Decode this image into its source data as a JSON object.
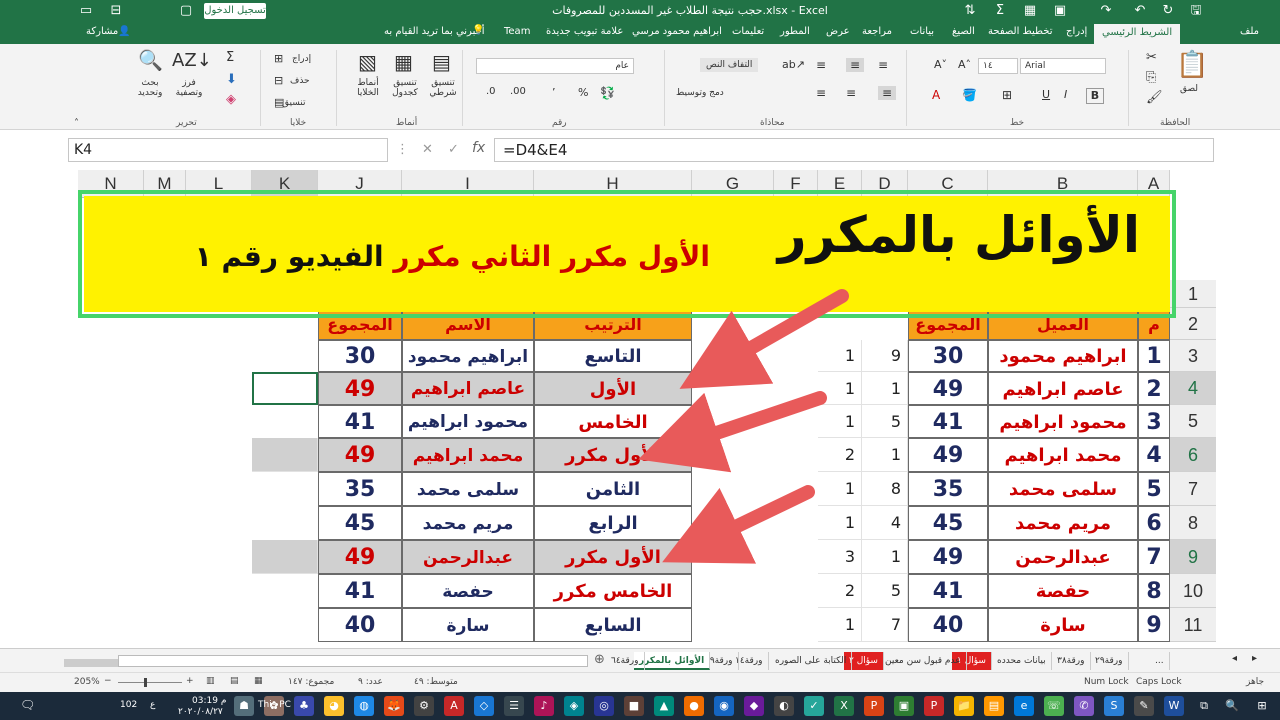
{
  "titlebar": {
    "title": "حجب نتيجة الطلاب غير المسددين للمصروفات.xlsx - Excel",
    "signin": "تسجيل الدخول"
  },
  "tabs": [
    "ملف",
    "الشريط الرئيسي",
    "إدراج",
    "تخطيط الصفحة",
    "الصيغ",
    "بيانات",
    "مراجعة",
    "عرض",
    "المطور",
    "تعليمات",
    "ابراهيم محمود مرسي",
    "علامة تبويب جديدة",
    "Team",
    "أخبرني بما تريد القيام به",
    "مشاركة"
  ],
  "ribbon": {
    "clipboard": "الحافظة",
    "font": "خط",
    "alignment": "محاذاة",
    "number": "رقم",
    "styles": "أنماط",
    "cells": "خلايا",
    "editing": "تحرير",
    "font_name": "Arial",
    "font_size": "١٤",
    "number_format": "عام",
    "paste": "لصق",
    "wrap": "التفاف النص",
    "merge": "دمج وتوسيط",
    "cond_format": "تنسيق شرطي",
    "format_table": "تنسيق كجدول",
    "cell_styles": "أنماط الخلايا",
    "insert": "إدراج",
    "delete": "حذف",
    "format": "تنسيق",
    "sort": "فرز وتصفية",
    "find": "بحث وتحديد",
    "bold": "B",
    "italic": "I",
    "underline": "U"
  },
  "formula": {
    "namebox": "K4",
    "fx": "=D4&E4"
  },
  "columns": [
    "A",
    "B",
    "C",
    "D",
    "E",
    "F",
    "G",
    "H",
    "I",
    "J",
    "K",
    "L",
    "M",
    "N"
  ],
  "rows": [
    "1",
    "2",
    "3",
    "4",
    "5",
    "6",
    "7",
    "8",
    "9",
    "10",
    "11"
  ],
  "banner": {
    "line1": "الأوائل بالمكرر",
    "l2a": "الفيديو رقم ١",
    "l2b": "مكرر",
    "l2c": "الثاني",
    "l2d": "مكرر",
    "l2e": "الأول"
  },
  "left_table": {
    "headers": [
      "م",
      "العميل",
      "المجموع"
    ],
    "rows": [
      {
        "n": "1",
        "name": "ابراهيم محمود",
        "total": "30",
        "d": "9",
        "e": "1"
      },
      {
        "n": "2",
        "name": "عاصم ابراهيم",
        "total": "49",
        "d": "1",
        "e": "1"
      },
      {
        "n": "3",
        "name": "محمود ابراهيم",
        "total": "41",
        "d": "5",
        "e": "1"
      },
      {
        "n": "4",
        "name": "محمد ابراهيم",
        "total": "49",
        "d": "1",
        "e": "2"
      },
      {
        "n": "5",
        "name": "سلمى محمد",
        "total": "35",
        "d": "8",
        "e": "1"
      },
      {
        "n": "6",
        "name": "مريم محمد",
        "total": "45",
        "d": "4",
        "e": "1"
      },
      {
        "n": "7",
        "name": "عبدالرحمن",
        "total": "49",
        "d": "1",
        "e": "3"
      },
      {
        "n": "8",
        "name": "حفصة",
        "total": "41",
        "d": "5",
        "e": "2"
      },
      {
        "n": "9",
        "name": "سارة",
        "total": "40",
        "d": "7",
        "e": "1"
      }
    ]
  },
  "right_table": {
    "headers": [
      "الترتيب",
      "الاسم",
      "المجموع"
    ],
    "rows": [
      {
        "rank": "التاسع",
        "name": "ابراهيم محمود",
        "total": "30",
        "hl": false
      },
      {
        "rank": "الأول",
        "name": "عاصم ابراهيم",
        "total": "49",
        "hl": true
      },
      {
        "rank": "الخامس",
        "name": "محمود ابراهيم",
        "total": "41",
        "hl": false
      },
      {
        "rank": "الأول مكرر",
        "name": "محمد ابراهيم",
        "total": "49",
        "hl": true
      },
      {
        "rank": "الثامن",
        "name": "سلمى محمد",
        "total": "35",
        "hl": false
      },
      {
        "rank": "الرابع",
        "name": "مريم محمد",
        "total": "45",
        "hl": false
      },
      {
        "rank": "الأول مكرر",
        "name": "عبدالرحمن",
        "total": "49",
        "hl": true
      },
      {
        "rank": "الخامس مكرر",
        "name": "حفصة",
        "total": "41",
        "hl": false
      },
      {
        "rank": "السابع",
        "name": "سارة",
        "total": "40",
        "hl": false
      }
    ]
  },
  "sheet_tabs": [
    "...",
    "ورقة٢٩",
    "ورقة٣٨",
    "بيانات محدده",
    "سؤال ١",
    "عدم قبول سن معين",
    "سؤال ٢",
    "الكتابة على الصوره",
    "ورقة١٤",
    "ورقة٤٩",
    "الأوائل بالمكرر",
    "ورقة٦٤"
  ],
  "status": {
    "mode": "جاهز",
    "caps": "Caps Lock",
    "num": "Num Lock",
    "avg": "متوسط: ٤٩",
    "count": "عدد: ٩",
    "sum": "مجموع: ١٤٧",
    "zoom": "205%"
  },
  "taskbar": {
    "time": "03:19 م",
    "date": "٢٠٢٠/٠٨/٢٧",
    "lang": "ع",
    "pc": "This PC",
    "count": "102"
  },
  "colors": {
    "excel_green": "#217346",
    "banner_yellow": "#fff200",
    "header_orange": "#f7a11a",
    "navy": "#1f2a60",
    "red": "#cc0000",
    "arrow": "#e85a5a",
    "banner_border": "#46d46a"
  }
}
